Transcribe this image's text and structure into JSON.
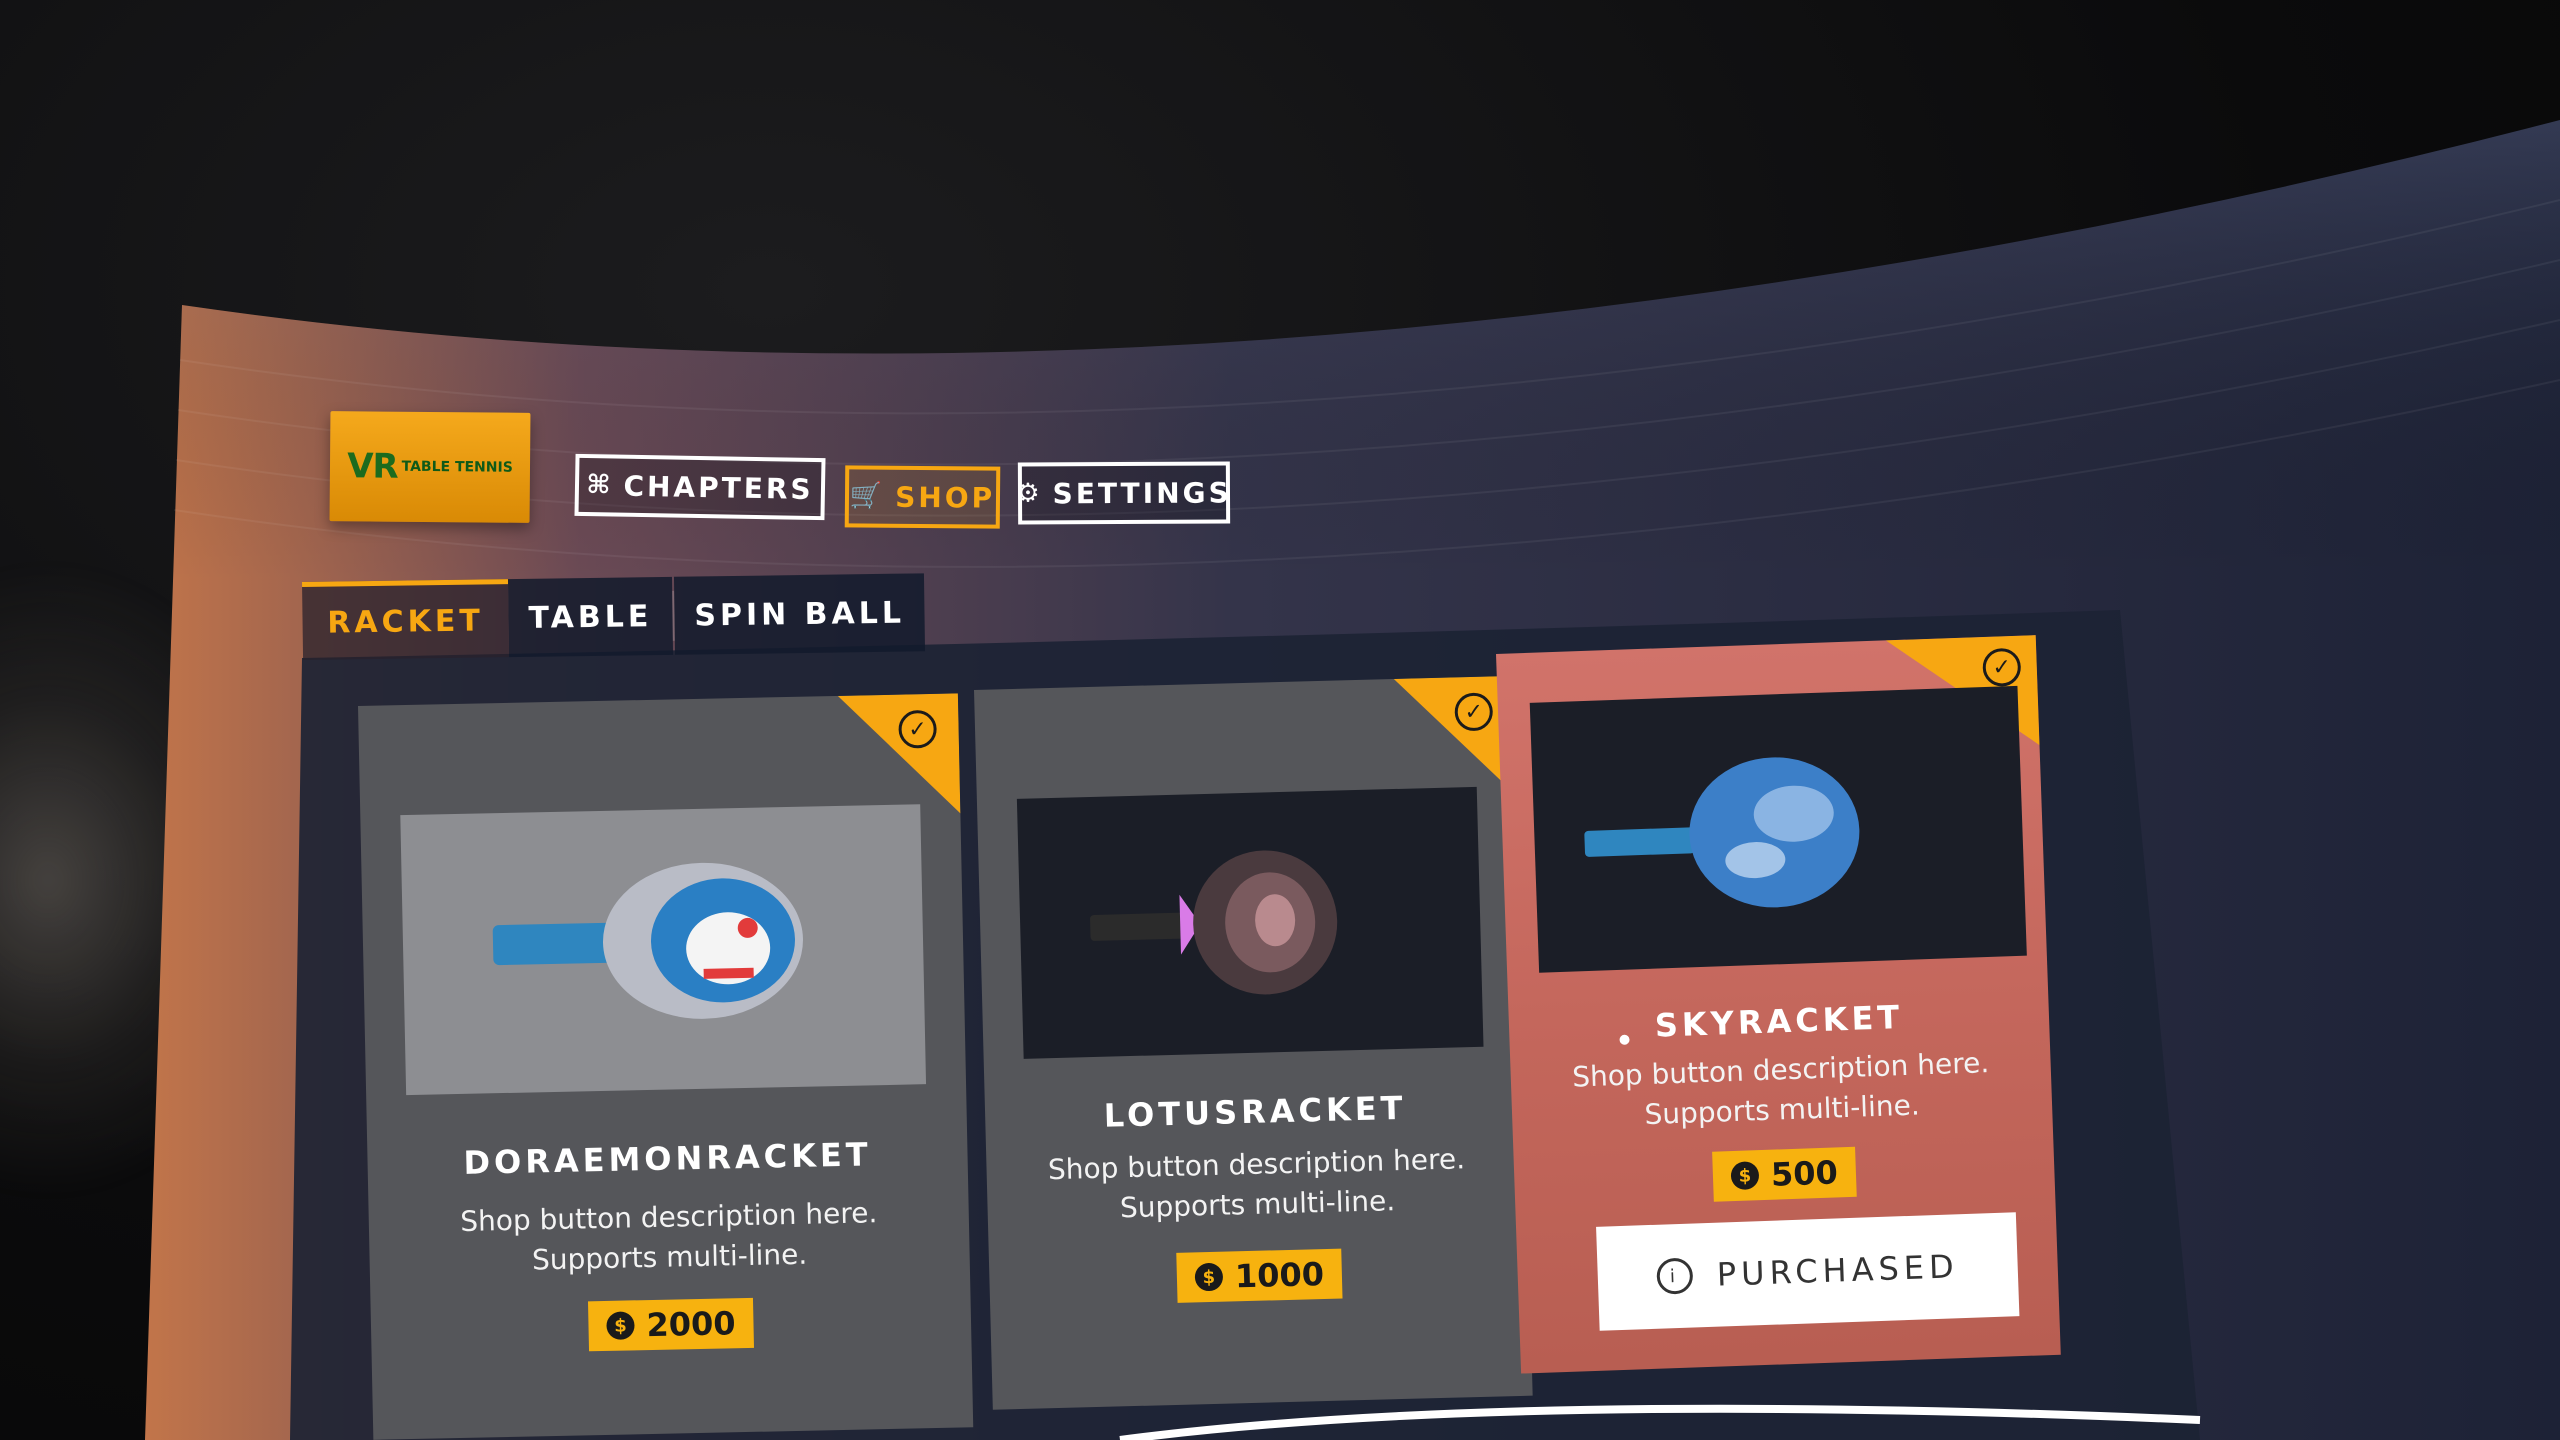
{
  "logo": {
    "text": "VR",
    "sub": "TABLE TENNIS"
  },
  "nav": [
    {
      "icon": "chapters-icon",
      "label": "CHAPTERS",
      "active": false
    },
    {
      "icon": "cart-icon",
      "label": "SHOP",
      "active": true
    },
    {
      "icon": "gear-icon",
      "label": "SETTINGS",
      "active": false
    }
  ],
  "tabs": [
    {
      "label": "RACKET",
      "active": true
    },
    {
      "label": "TABLE",
      "active": false
    },
    {
      "label": "SPIN BALL",
      "active": false
    }
  ],
  "cards": [
    {
      "name": "DORAEMONRACKET",
      "desc_line1": "Shop button description here.",
      "desc_line2": "Supports multi-line.",
      "price": "2000",
      "owned_check": true
    },
    {
      "name": "LOTUSRACKET",
      "desc_line1": "Shop button description here.",
      "desc_line2": "Supports multi-line.",
      "price": "1000",
      "owned_check": true
    },
    {
      "name": "SKYRACKET",
      "desc_line1": "Shop button description here.",
      "desc_line2": "Supports multi-line.",
      "price": "500",
      "owned_check": true,
      "button_label": "PURCHASED",
      "selected": true
    }
  ],
  "colors": {
    "accent": "#f7a712",
    "card_grey": "#55565a",
    "card_selected": "#c96b60",
    "panel": "#1a2135"
  }
}
